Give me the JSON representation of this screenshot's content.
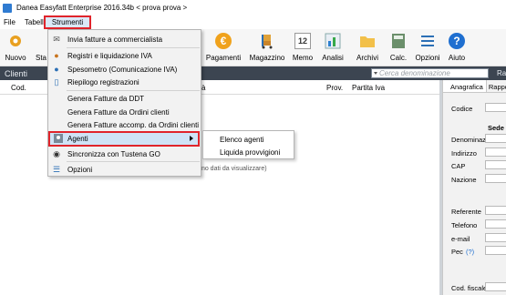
{
  "window": {
    "title": "Danea Easyfatt Enterprise  2016.34b   < prova prova >"
  },
  "menubar": {
    "file": "File",
    "tabelle": "Tabelle",
    "strumenti": "Strumenti"
  },
  "toolbar": {
    "nuovo": "Nuovo",
    "sta": "Sta",
    "pagamenti": "Pagamenti",
    "magazzino": "Magazzino",
    "memo": "Memo",
    "memo_icon_text": "12",
    "analisi": "Analisi",
    "archivi": "Archivi",
    "calc": "Calc.",
    "opzioni": "Opzioni",
    "aiuto": "Aiuto"
  },
  "section": {
    "title": "Clienti",
    "search_placeholder": "Cerca denominazione",
    "right_label": "Ra"
  },
  "grid": {
    "columns": [
      "Cod.",
      "à",
      "Prov.",
      "Partita Iva"
    ],
    "empty_text": "(Non vi sono dati da visualizzare)"
  },
  "detail_panel": {
    "tabs": [
      "Anagrafica",
      "Rapport"
    ],
    "codice": "Codice",
    "sede_header": "Sede c",
    "fields": [
      "Denominaz.",
      "Indirizzo",
      "CAP",
      "Nazione",
      "Referente",
      "Telefono",
      "e-mail",
      "Pec",
      "Cod. fiscale"
    ],
    "pec_help": "(?)"
  },
  "strumenti_menu": {
    "items": [
      "Invia fatture a commercialista",
      "Registri e liquidazione IVA",
      "Spesometro (Comunicazione IVA)",
      "Riepilogo registrazioni",
      "Genera Fatture da DDT",
      "Genera Fatture da Ordini clienti",
      "Genera Fatture accomp. da Ordini clienti",
      "Agenti",
      "Sincronizza con Tustena GO",
      "Opzioni"
    ]
  },
  "agenti_submenu": {
    "items": [
      "Elenco agenti",
      "Liquida provvigioni"
    ]
  },
  "colors": {
    "accent_red": "#e0242b",
    "dark_bar": "#3c4551",
    "highlight_blue": "#cfe3f6"
  }
}
